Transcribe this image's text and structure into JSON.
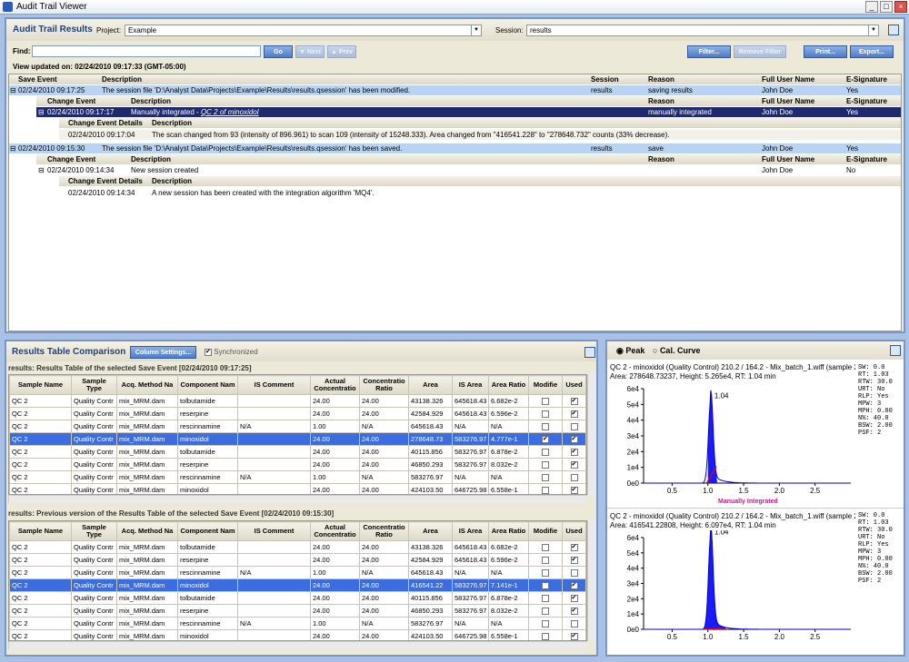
{
  "window": {
    "title": "Audit Trail Viewer"
  },
  "top": {
    "title": "Audit Trail Results",
    "project_label": "Project:",
    "project_value": "Example",
    "session_label": "Session:",
    "session_value": "results"
  },
  "find": {
    "label": "Find:",
    "value": "",
    "go": "Go",
    "next": "Next",
    "prev": "Prev"
  },
  "buttons": {
    "filter": "Filter...",
    "remove_filter": "Remove Filter",
    "print": "Print...",
    "export": "Export..."
  },
  "view_updated": "View updated on: 02/24/2010 09:17:33 (GMT-05:00)",
  "audit": {
    "headers": [
      "Save Event",
      "Description",
      "Session",
      "Reason",
      "Full User Name",
      "E-Signature"
    ],
    "sub_headers": [
      "Change Event",
      "Description",
      "Reason",
      "Full User Name",
      "E-Signature"
    ],
    "detail_headers": [
      "Change Event Details",
      "Description"
    ],
    "e1": {
      "time": "02/24/2010 09:17:25",
      "desc": "The session file 'D:\\Analyst Data\\Projects\\Example\\Results\\results.qsession' has been modified.",
      "session": "results",
      "reason": "saving results",
      "user": "John Doe",
      "esig": "Yes"
    },
    "e1c": {
      "time": "02/24/2010 09:17:17",
      "desc": "Manually integrated - ",
      "link": "QC 2 of minoxidol",
      "reason": "manually integrated",
      "user": "John Doe",
      "esig": "Yes"
    },
    "e1d": {
      "time": "02/24/2010 09:17:04",
      "desc": "The scan changed from 93 (intensity of 896.961) to scan 109 (intensity of 15248.333). Area changed from \"416541.228\" to \"278648.732\" counts (33% decrease)."
    },
    "e2": {
      "time": "02/24/2010 09:15:30",
      "desc": "The session file 'D:\\Analyst Data\\Projects\\Example\\Results\\results.qsession' has been saved.",
      "session": "results",
      "reason": "save",
      "user": "John Doe",
      "esig": "Yes"
    },
    "e2c": {
      "time": "02/24/2010 09:14:34",
      "desc": "New session created",
      "user": "John Doe",
      "esig": "No"
    },
    "e2d": {
      "time": "02/24/2010 09:14:34",
      "desc": "A new session has been created with the integration algorithm 'MQ4'."
    }
  },
  "comparison": {
    "title": "Results Table Comparison",
    "column_settings": "Column Settings...",
    "synchronized": "Synchronized",
    "cur_caption": "results: Results Table of the selected Save Event  [02/24/2010 09:17:25]",
    "prev_caption": "results: Previous version of the Results Table of the selected Save Event  [02/24/2010 09:15:30]",
    "columns": [
      "Sample Name",
      "Sample Type",
      "Acq. Method Na",
      "Component Nam",
      "IS Comment",
      "Actual Concentratio",
      "Concentratio Ratio",
      "Area",
      "IS Area",
      "Area Ratio",
      "Modifie",
      "Used"
    ],
    "cur_rows": [
      [
        "QC 2",
        "Quality Contr",
        "mix_MRM.dam",
        "tolbutamide",
        "",
        "24.00",
        "24.00",
        "43138.326",
        "645618.43",
        "6.682e-2",
        false,
        true
      ],
      [
        "QC 2",
        "Quality Contr",
        "mix_MRM.dam",
        "reserpine",
        "",
        "24.00",
        "24.00",
        "42584.929",
        "645618.43",
        "6.596e-2",
        false,
        true
      ],
      [
        "QC 2",
        "Quality Contr",
        "mix_MRM.dam",
        "rescinnamine",
        "N/A",
        "1.00",
        "N/A",
        "645618.43",
        "N/A",
        "N/A",
        false,
        false
      ],
      [
        "QC 2",
        "Quality Contr",
        "mix_MRM.dam",
        "minoxidol",
        "",
        "24.00",
        "24.00",
        "278648.73",
        "583276.97",
        "4.777e-1",
        true,
        true
      ],
      [
        "QC 2",
        "Quality Contr",
        "mix_MRM.dam",
        "tolbutamide",
        "",
        "24.00",
        "24.00",
        "40115.856",
        "583276.97",
        "6.878e-2",
        false,
        true
      ],
      [
        "QC 2",
        "Quality Contr",
        "mix_MRM.dam",
        "reserpine",
        "",
        "24.00",
        "24.00",
        "46850.293",
        "583276.97",
        "8.032e-2",
        false,
        true
      ],
      [
        "QC 2",
        "Quality Contr",
        "mix_MRM.dam",
        "rescinnamine",
        "N/A",
        "1.00",
        "N/A",
        "583276.97",
        "N/A",
        "N/A",
        false,
        false
      ],
      [
        "QC 2",
        "Quality Contr",
        "mix_MRM.dam",
        "minoxidol",
        "",
        "24.00",
        "24.00",
        "424103.50",
        "646725.98",
        "6.558e-1",
        false,
        true
      ]
    ],
    "prev_rows": [
      [
        "QC 2",
        "Quality Contr",
        "mix_MRM.dam",
        "tolbutamide",
        "",
        "24.00",
        "24.00",
        "43138.326",
        "645618.43",
        "6.682e-2",
        false,
        true
      ],
      [
        "QC 2",
        "Quality Contr",
        "mix_MRM.dam",
        "reserpine",
        "",
        "24.00",
        "24.00",
        "42584.929",
        "645618.43",
        "6.596e-2",
        false,
        true
      ],
      [
        "QC 2",
        "Quality Contr",
        "mix_MRM.dam",
        "rescinnamine",
        "N/A",
        "1.00",
        "N/A",
        "645618.43",
        "N/A",
        "N/A",
        false,
        false
      ],
      [
        "QC 2",
        "Quality Contr",
        "mix_MRM.dam",
        "minoxidol",
        "",
        "24.00",
        "24.00",
        "416541.22",
        "583276.97",
        "7.141e-1",
        false,
        true
      ],
      [
        "QC 2",
        "Quality Contr",
        "mix_MRM.dam",
        "tolbutamide",
        "",
        "24.00",
        "24.00",
        "40115.856",
        "583276.97",
        "6.878e-2",
        false,
        true
      ],
      [
        "QC 2",
        "Quality Contr",
        "mix_MRM.dam",
        "reserpine",
        "",
        "24.00",
        "24.00",
        "46850.293",
        "583276.97",
        "8.032e-2",
        false,
        true
      ],
      [
        "QC 2",
        "Quality Contr",
        "mix_MRM.dam",
        "rescinnamine",
        "N/A",
        "1.00",
        "N/A",
        "583276.97",
        "N/A",
        "N/A",
        false,
        false
      ],
      [
        "QC 2",
        "Quality Contr",
        "mix_MRM.dam",
        "minoxidol",
        "",
        "24.00",
        "24.00",
        "424103.50",
        "646725.98",
        "6.558e-1",
        false,
        true
      ]
    ],
    "selected_row": 3
  },
  "plots": {
    "peak": "Peak",
    "cal": "Cal. Curve",
    "p1": {
      "line1": "QC 2 - minoxidol (Quality Control) 210.2 / 164.2 - Mix_batch_1.wiff (sample 2...",
      "line2": "Area: 278648.73237, Height: 5.265e4, RT: 1.04 min",
      "peak_label": "1.04",
      "footer": "Manually Integrated",
      "params": [
        "SW: 0.0",
        "RT: 1.03",
        "RTW: 30.0",
        "URT: No",
        "RLP: Yes",
        "MPW: 3",
        "MPH: 0.00",
        "N%: 40.0",
        "BSW: 2.00",
        "PSF: 2"
      ]
    },
    "p2": {
      "line1": "QC 2 - minoxidol (Quality Control) 210.2 / 164.2 - Mix_batch_1.wiff (sample 2...",
      "line2": "Area: 416541.22808, Height: 6.097e4, RT: 1.04 min",
      "peak_label": "1.04",
      "params": [
        "SW: 0.0",
        "RT: 1.03",
        "RTW: 30.0",
        "URT: No",
        "RLP: Yes",
        "MPW: 3",
        "MPH: 0.00",
        "N%: 40.0",
        "BSW: 2.00",
        "PSF: 2"
      ]
    },
    "yticks": [
      "6e4",
      "5e4",
      "4e4",
      "3e4",
      "2e4",
      "1e4",
      "0e0"
    ],
    "xticks": [
      "0.5",
      "1.0",
      "1.5",
      "2.0",
      "2.5"
    ]
  }
}
